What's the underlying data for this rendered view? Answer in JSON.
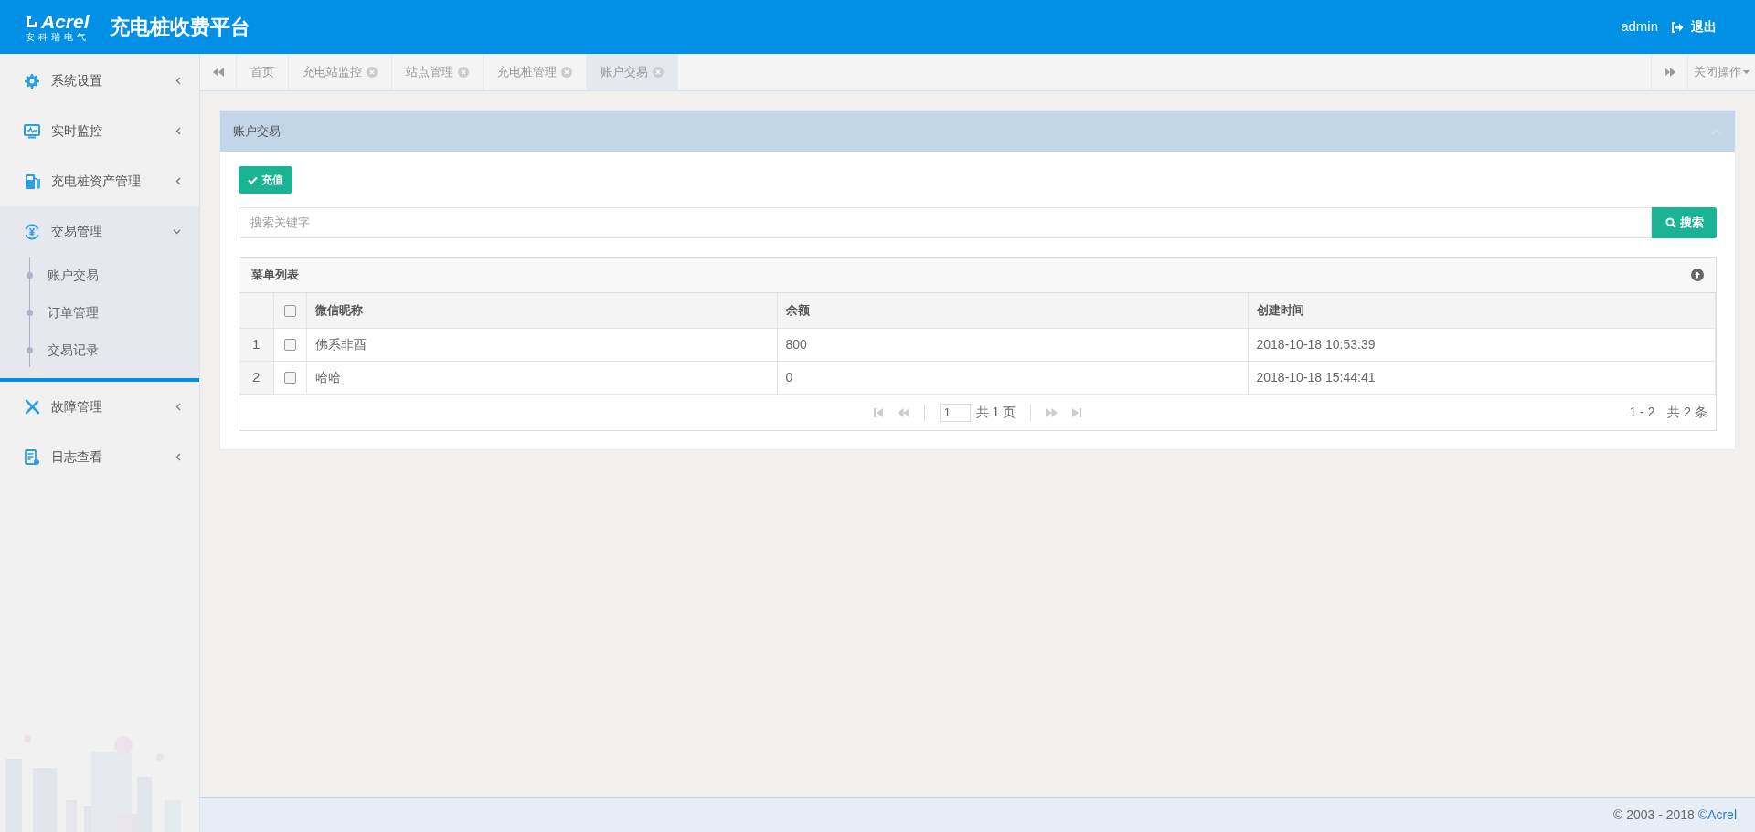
{
  "header": {
    "logo_text": "Acrel",
    "logo_subtext": "安科瑞电气",
    "title": "充电桩收费平台",
    "user": "admin",
    "logout": "退出"
  },
  "sidebar": {
    "items": [
      {
        "label": "系统设置",
        "expanded": false
      },
      {
        "label": "实时监控",
        "expanded": false
      },
      {
        "label": "充电桩资产管理",
        "expanded": false
      },
      {
        "label": "交易管理",
        "expanded": true,
        "children": [
          {
            "label": "账户交易"
          },
          {
            "label": "订单管理"
          },
          {
            "label": "交易记录"
          }
        ]
      },
      {
        "label": "故障管理",
        "expanded": false
      },
      {
        "label": "日志查看",
        "expanded": false
      }
    ]
  },
  "tabs": [
    {
      "label": "首页",
      "closable": false,
      "selected": false
    },
    {
      "label": "充电站监控",
      "closable": true,
      "selected": false
    },
    {
      "label": "站点管理",
      "closable": true,
      "selected": false
    },
    {
      "label": "充电桩管理",
      "closable": true,
      "selected": false
    },
    {
      "label": "账户交易",
      "closable": true,
      "selected": true
    }
  ],
  "close_menu": "关闭操作",
  "panel": {
    "title": "账户交易",
    "recharge_button": "充值",
    "search": {
      "placeholder": "搜索关键字",
      "button": "搜索"
    },
    "table": {
      "title": "菜单列表",
      "columns": [
        "微信昵称",
        "余额",
        "创建时间"
      ],
      "header_checked": false,
      "rows": [
        {
          "index": "1",
          "checked": false,
          "cells": [
            "佛系非酉",
            "800",
            "2018-10-18 10:53:39"
          ]
        },
        {
          "index": "2",
          "checked": false,
          "cells": [
            "哈哈",
            "0",
            "2018-10-18 15:44:41"
          ]
        }
      ],
      "pagination": {
        "page": "1",
        "total_pages": "共 1 页",
        "range": "1 - 2",
        "total": "共 2 条"
      }
    }
  },
  "footer": {
    "copyright": "© 2003 - 2018 ",
    "brand": "©Acrel"
  }
}
